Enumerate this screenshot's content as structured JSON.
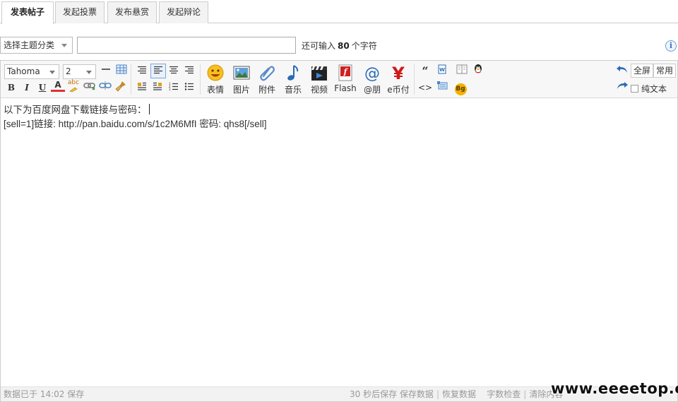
{
  "tabs": [
    {
      "label": "发表帖子",
      "active": true
    },
    {
      "label": "发起投票",
      "active": false
    },
    {
      "label": "发布悬赏",
      "active": false
    },
    {
      "label": "发起辩论",
      "active": false
    }
  ],
  "subject": {
    "category_value": "选择主题分类",
    "input_value": "",
    "char_prefix": "还可输入",
    "char_count": "80",
    "char_suffix": "个字符",
    "info_icon": "i"
  },
  "toolbar": {
    "font_family": "Tahoma",
    "font_size": "2",
    "format_buttons": {
      "bold": "B",
      "italic": "I",
      "underline": "U",
      "font_color": "A",
      "highlight": "abc"
    },
    "big_buttons": [
      {
        "label": "表情",
        "icon": "smiley-icon"
      },
      {
        "label": "图片",
        "icon": "image-icon"
      },
      {
        "label": "附件",
        "icon": "paperclip-icon"
      },
      {
        "label": "音乐",
        "icon": "music-note-icon"
      },
      {
        "label": "视频",
        "icon": "clapperboard-icon"
      },
      {
        "label": "Flash",
        "icon": "flash-icon"
      },
      {
        "label": "@朋",
        "icon": "at-sign-icon"
      },
      {
        "label": "e币付",
        "icon": "yuan-icon"
      }
    ],
    "fullscreen_label": "全屏",
    "common_label": "常用",
    "plain_text_label": "纯文本",
    "quote_glyph": "“",
    "code_glyph": "<>",
    "bg_glyph": "Bg"
  },
  "content": {
    "line1": "以下为百度网盘下载链接与密码：",
    "line2": "[sell=1]链接: http://pan.baidu.com/s/1c2M6MfI 密码: qhs8[/sell]"
  },
  "status": {
    "left": "数据已于 14:02 保存",
    "autosave": "30 秒后保存",
    "save_data": "保存数据",
    "restore_data": "恢复数据",
    "word_check": "字数检查",
    "clear_content": "清除内容"
  },
  "watermark": "www.eeeetop.com",
  "colors": {
    "accent_blue": "#2f6fbf",
    "border": "#cdcdcd",
    "toolbar_bg": "#f7f7f7"
  }
}
